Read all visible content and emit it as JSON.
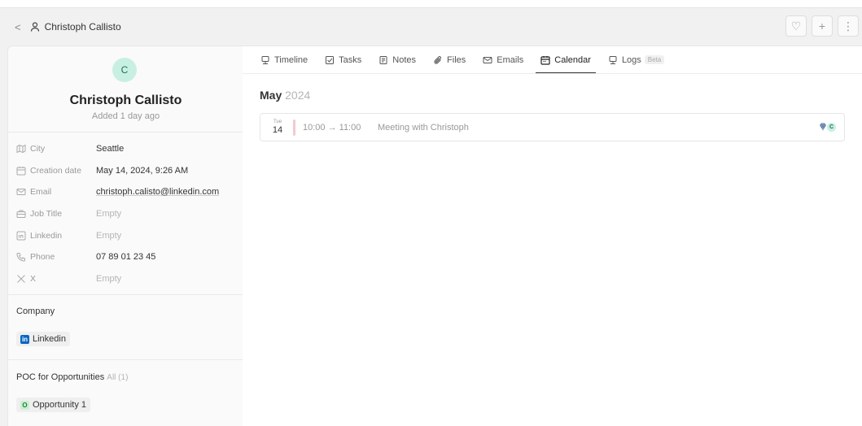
{
  "header": {
    "back_glyph": "<",
    "title": "Christoph Callisto",
    "actions": [
      {
        "name": "favorite-button",
        "icon": "heart-icon",
        "glyph": "♡"
      },
      {
        "name": "add-button",
        "icon": "plus-icon",
        "glyph": "+"
      },
      {
        "name": "more-button",
        "icon": "more-vertical-icon",
        "glyph": "⋮"
      }
    ]
  },
  "profile": {
    "avatar_initial": "C",
    "name": "Christoph Callisto",
    "added": "Added 1 day ago",
    "fields": [
      {
        "key": "city",
        "icon": "map-icon",
        "label": "City",
        "value": "Seattle",
        "empty": false
      },
      {
        "key": "creation-date",
        "icon": "calendar-icon",
        "label": "Creation date",
        "value": "May 14, 2024, 9:26 AM",
        "empty": false
      },
      {
        "key": "email",
        "icon": "mail-icon",
        "label": "Email",
        "value": "christoph.calisto@linkedin.com",
        "empty": false
      },
      {
        "key": "job-title",
        "icon": "briefcase-icon",
        "label": "Job Title",
        "value": "Empty",
        "empty": true
      },
      {
        "key": "linkedin",
        "icon": "linkedin-icon",
        "label": "Linkedin",
        "value": "Empty",
        "empty": true
      },
      {
        "key": "phone",
        "icon": "phone-icon",
        "label": "Phone",
        "value": "07 89 01 23 45",
        "empty": false
      },
      {
        "key": "x",
        "icon": "x-icon",
        "label": "X",
        "value": "Empty",
        "empty": true
      }
    ],
    "company": {
      "title": "Company",
      "chip_icon": "in",
      "chip_label": "Linkedin"
    },
    "poc": {
      "title": "POC for Opportunities",
      "count": "All (1)",
      "chip_icon": "O",
      "chip_label": "Opportunity 1"
    }
  },
  "tabs": [
    {
      "key": "timeline",
      "icon": "timeline-icon",
      "label": "Timeline",
      "active": false
    },
    {
      "key": "tasks",
      "icon": "checkbox-icon",
      "label": "Tasks",
      "active": false
    },
    {
      "key": "notes",
      "icon": "notes-icon",
      "label": "Notes",
      "active": false
    },
    {
      "key": "files",
      "icon": "paperclip-icon",
      "label": "Files",
      "active": false
    },
    {
      "key": "emails",
      "icon": "mail-icon",
      "label": "Emails",
      "active": false
    },
    {
      "key": "calendar",
      "icon": "calendar-icon",
      "label": "Calendar",
      "active": true
    },
    {
      "key": "logs",
      "icon": "logs-icon",
      "label": "Logs",
      "active": false,
      "badge": "Beta"
    }
  ],
  "calendar": {
    "month": "May",
    "year": "2024",
    "events": [
      {
        "weekday": "Tue",
        "day": "14",
        "time": "10:00 → 11:00",
        "title": "Meeting with Christoph",
        "attendee_initial": "C",
        "accent": "#f5c9cf"
      }
    ]
  }
}
